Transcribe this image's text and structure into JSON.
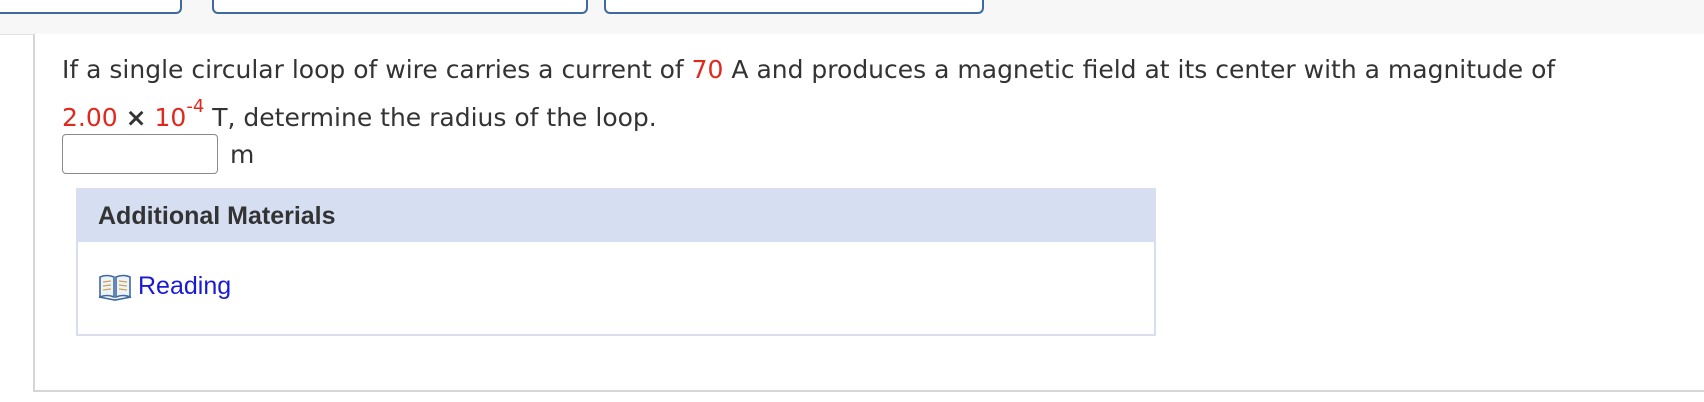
{
  "question": {
    "part1": "If a single circular loop of wire carries a current of",
    "current_value": "70",
    "part2": "A and produces a magnetic field at its center with a magnitude of",
    "field_mantissa": "2.00",
    "times": "×",
    "field_base": "10",
    "field_exponent": "-4",
    "part3": "T, determine the radius of the loop."
  },
  "answer": {
    "value": "",
    "unit": "m"
  },
  "materials": {
    "header": "Additional Materials",
    "reading_label": "Reading"
  },
  "colors": {
    "variable_red": "#e0281e",
    "link_blue": "#1a1ad6",
    "header_bg": "#d6def2",
    "tab_border": "#3f6aa0"
  }
}
